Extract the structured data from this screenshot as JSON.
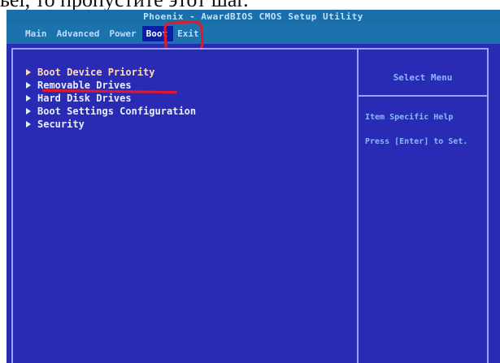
{
  "caption": "ьеі, то пропустите этот шаг.",
  "bios": {
    "title": "Phoenix - AwardBIOS CMOS Setup Utility",
    "menu": [
      {
        "label": "Main"
      },
      {
        "label": "Advanced"
      },
      {
        "label": "Power"
      },
      {
        "label": "Boot"
      },
      {
        "label": "Exit"
      }
    ],
    "active_menu": "Boot",
    "items": [
      {
        "label": "Boot Device Priority"
      },
      {
        "label": "Removable Drives"
      },
      {
        "label": "Hard Disk Drives"
      },
      {
        "label": "Boot Settings Configuration"
      },
      {
        "label": "Security"
      }
    ],
    "help": {
      "title": "Select Menu",
      "line1": "Item Specific Help",
      "line2": "Press [Enter] to Set."
    }
  },
  "colors": {
    "screen_background": "#2a2bb4",
    "menubar": "#1b72ad",
    "annotation": "#e4182a"
  }
}
